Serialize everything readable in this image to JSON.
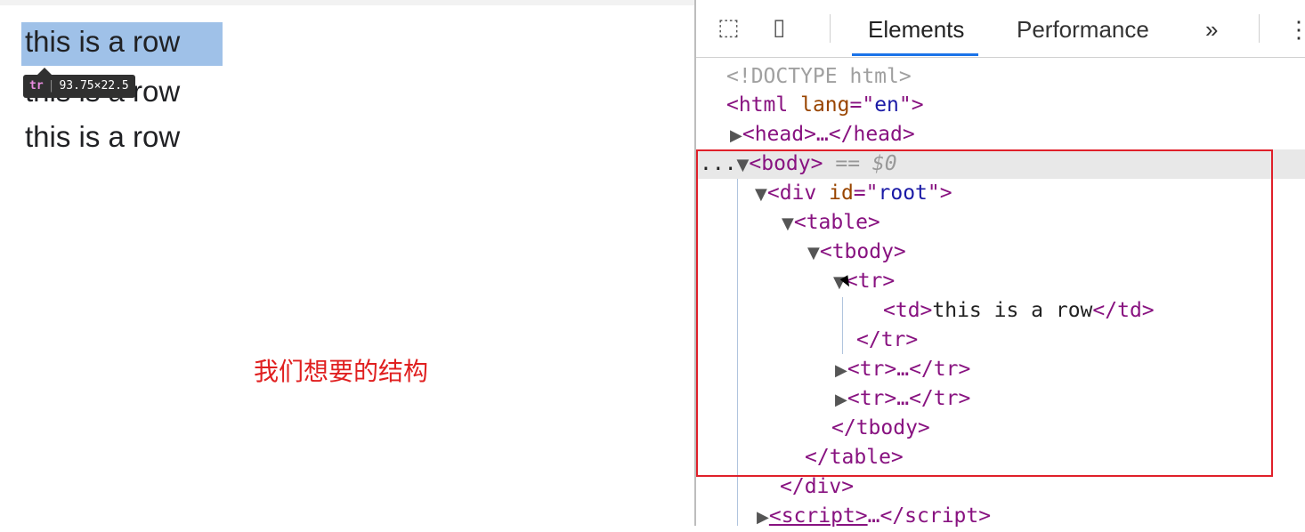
{
  "page": {
    "rows": [
      "this is a row",
      "this is a row",
      "this is a row"
    ],
    "tooltip": {
      "tag": "tr",
      "size": "93.75×22.5"
    },
    "annotation": "我们想要的结构"
  },
  "devtools": {
    "toolbar": {
      "inspect_icon": "inspect-element-icon",
      "device_icon": "device-toolbar-icon",
      "tabs": [
        "Elements",
        "Performance"
      ],
      "more": "»",
      "menu": "⋮"
    },
    "lines": {
      "doctype": "<!DOCTYPE html>",
      "html_open": "<html",
      "html_attr": "lang",
      "html_val": "en",
      "head": "<head>…</head>",
      "body_prefix": "...",
      "body": "<body>",
      "body_sel": "== $0",
      "div_attr": "id",
      "div_val": "root",
      "td_text": "this is a row"
    }
  }
}
